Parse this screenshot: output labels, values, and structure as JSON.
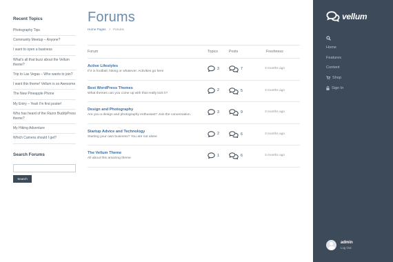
{
  "recent_topics": {
    "heading": "Recent Topics",
    "items": [
      "Photography Tips",
      "Community Meetup – Anyone?",
      "I want to open a business",
      "What's all that buzz about the Vellum theme?",
      "Trip to Las Vegas – Who wants to join?",
      "I want this theme! Vellum is so Awesome",
      "The New Pineapple Phone",
      "My Entry – Yeah I'm first poster!",
      "Who has heard of the Razor BuddyPress theme?",
      "My Hiking Adventure",
      "Which Camera should I get?"
    ]
  },
  "search_forums": {
    "heading": "Search Forums",
    "input_value": "",
    "button_label": "Search"
  },
  "main": {
    "title": "Forums",
    "breadcrumb": {
      "home": "Home Pages",
      "separator": ">",
      "current": "Forums"
    },
    "columns": {
      "forum": "Forum",
      "topics": "Topics",
      "posts": "Posts",
      "freshness": "Freshness"
    },
    "rows": [
      {
        "name": "Active Lifestyles",
        "description": "If it is football, hiking or whatever. Activities go here",
        "topics": "3",
        "posts": "7",
        "freshness": "3 months ago"
      },
      {
        "name": "Best WordPress Themes",
        "description": "What themes can you come up with that really kick it?",
        "topics": "2",
        "posts": "5",
        "freshness": "3 months ago"
      },
      {
        "name": "Design and Photography",
        "description": "Are you a design and photography enthusiast? Join the conversation.",
        "topics": "3",
        "posts": "9",
        "freshness": "3 months ago"
      },
      {
        "name": "Startup Advice and Technology",
        "description": "Starting your own business? You are not alone",
        "topics": "2",
        "posts": "6",
        "freshness": "3 months ago"
      },
      {
        "name": "The Vellum Theme",
        "description": "All about this amazing theme",
        "topics": "1",
        "posts": "6",
        "freshness": "3 months ago"
      }
    ]
  },
  "sidebar": {
    "brand": "vellum",
    "nav": [
      {
        "label": "Home",
        "icon": ""
      },
      {
        "label": "Features",
        "icon": ""
      },
      {
        "label": "Content",
        "icon": ""
      },
      {
        "label": "Shop",
        "icon": "cart-icon"
      },
      {
        "label": "Sign In",
        "icon": "lock-icon"
      }
    ],
    "user": {
      "name": "admin",
      "logout": "Log Out"
    }
  },
  "colors": {
    "sidebar_bg": "#3c4a5a",
    "link_blue": "#3b6ea5",
    "title_blue": "#6b8cad",
    "button_dark": "#3c4a57"
  }
}
